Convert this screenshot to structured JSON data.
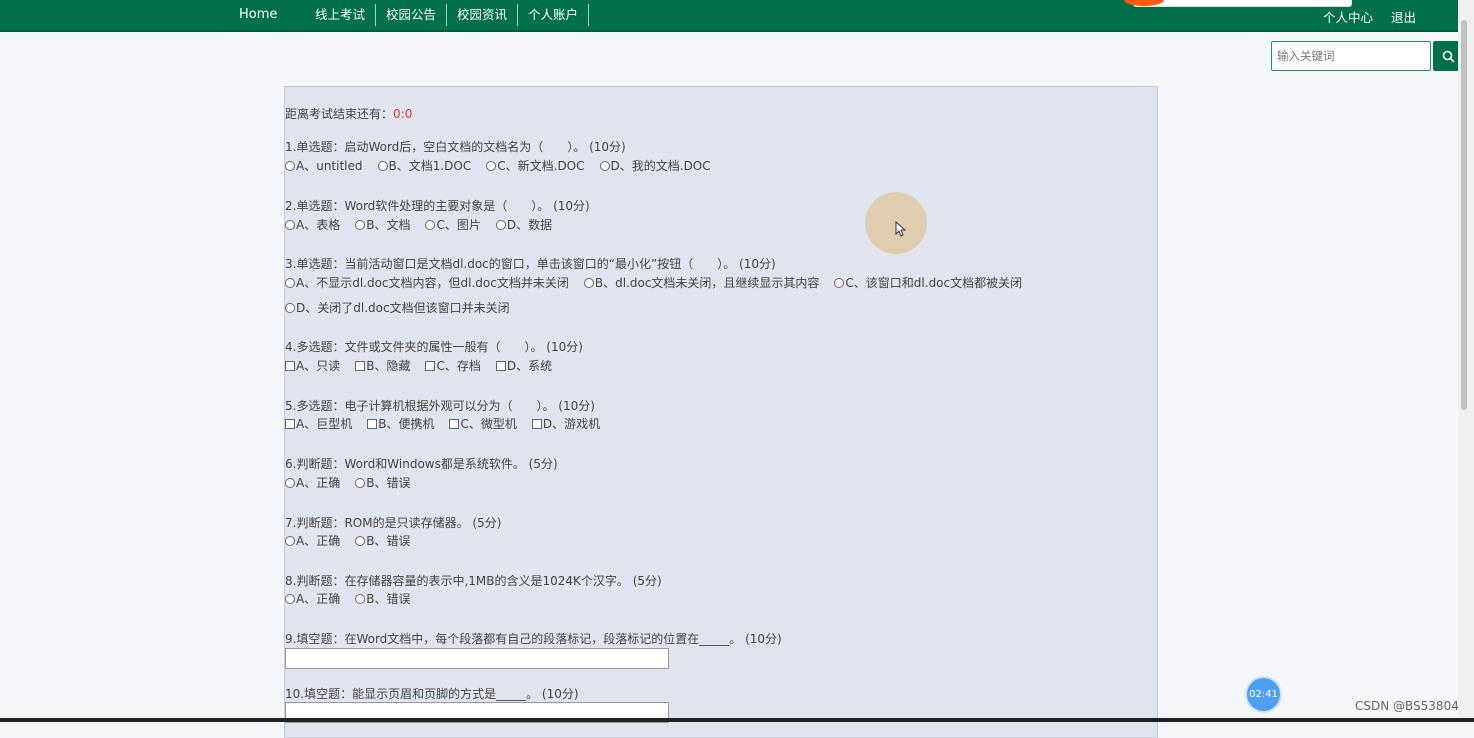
{
  "nav": {
    "home": "Home",
    "links": [
      "线上考试",
      "校园公告",
      "校园资讯",
      "个人账户"
    ],
    "right": [
      "个人中心",
      "退出"
    ]
  },
  "search": {
    "placeholder": "输入关键词"
  },
  "exam": {
    "timer_label": "距离考试结束还有：",
    "timer_value": "0:0",
    "questions": [
      {
        "text": "1.单选题：启动Word后，空白文档的文档名为（　　）。 (10分)",
        "type": "radio",
        "options": [
          "A、untitled",
          "B、文档1.DOC",
          "C、新文档.DOC",
          "D、我的文档.DOC"
        ]
      },
      {
        "text": "2.单选题：Word软件处理的主要对象是（　　）。 (10分)",
        "type": "radio",
        "options": [
          "A、表格",
          "B、文档",
          "C、图片",
          "D、数据"
        ]
      },
      {
        "text": "3.单选题：当前活动窗口是文档dl.doc的窗口，单击该窗口的“最小化”按钮（　　）。 (10分)",
        "type": "radio",
        "options": [
          "A、不显示dl.doc文档内容，但dl.doc文档并未关闭",
          "B、dl.doc文档未关闭，且继续显示其内容",
          "C、该窗口和dl.doc文档都被关闭"
        ],
        "options_line2": [
          "D、关闭了dl.doc文档但该窗口并未关闭"
        ]
      },
      {
        "text": "4.多选题：文件或文件夹的属性一般有（　　）。 (10分)",
        "type": "check",
        "options": [
          "A、只读",
          "B、隐藏",
          "C、存档",
          "D、系统"
        ]
      },
      {
        "text": "5.多选题：电子计算机根据外观可以分为（　　）。 (10分)",
        "type": "check",
        "options": [
          "A、巨型机",
          "B、便携机",
          "C、微型机",
          "D、游戏机"
        ]
      },
      {
        "text": "6.判断题：Word和Windows都是系统软件。 (5分)",
        "type": "radio",
        "options": [
          "A、正确",
          "B、错误"
        ]
      },
      {
        "text": "7.判断题：ROM的是只读存储器。 (5分)",
        "type": "radio",
        "options": [
          "A、正确",
          "B、错误"
        ]
      },
      {
        "text": "8.判断题：在存储器容量的表示中,1MB的含义是1024K个汉字。 (5分)",
        "type": "radio",
        "options": [
          "A、正确",
          "B、错误"
        ]
      },
      {
        "text": "9.填空题：在Word文档中，每个段落都有自己的段落标记，段落标记的位置在_____。 (10分)",
        "type": "fill"
      },
      {
        "text": "10.填空题：能显示页眉和页脚的方式是_____。 (10分)",
        "type": "fill"
      }
    ]
  },
  "clock": "02:41",
  "watermark": "CSDN @BS53804"
}
